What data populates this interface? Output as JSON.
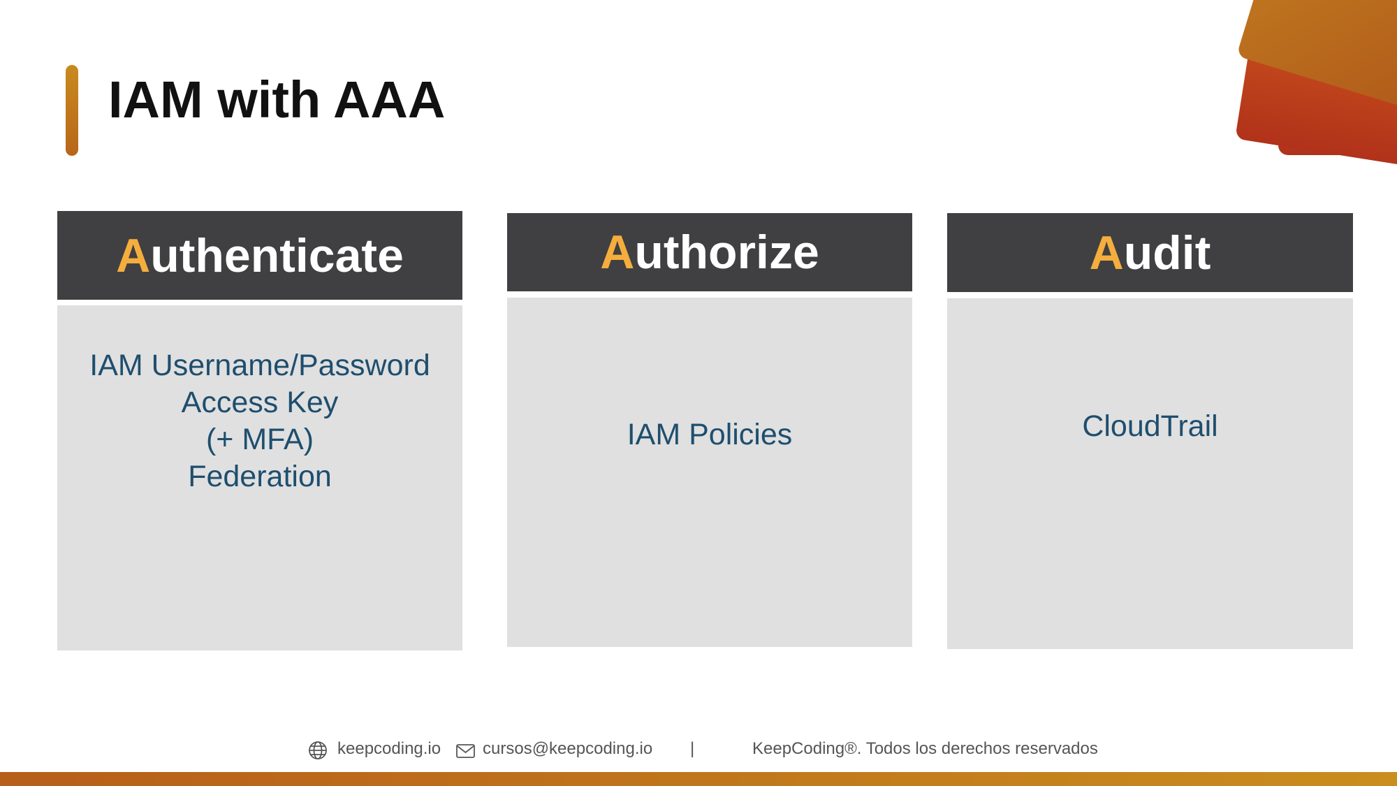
{
  "title": "IAM with AAA",
  "columns": [
    {
      "accent_letter": "A",
      "rest": "uthenticate",
      "items": [
        "IAM Username/Password",
        "Access Key",
        "(+ MFA)",
        "Federation"
      ]
    },
    {
      "accent_letter": "A",
      "rest": "uthorize",
      "items": [
        "IAM Policies"
      ]
    },
    {
      "accent_letter": "A",
      "rest": "udit",
      "items": [
        "CloudTrail"
      ]
    }
  ],
  "footer": {
    "website": "keepcoding.io",
    "email": "cursos@keepcoding.io",
    "separator": "|",
    "copyright": "KeepCoding®. Todos los derechos reservados",
    "website_icon": "globe-icon",
    "email_icon": "mail-icon"
  },
  "colors": {
    "accent": "#f5ae3d",
    "header_bg": "#404042",
    "body_bg": "#e0e0e0",
    "body_text": "#1e4e6e"
  }
}
